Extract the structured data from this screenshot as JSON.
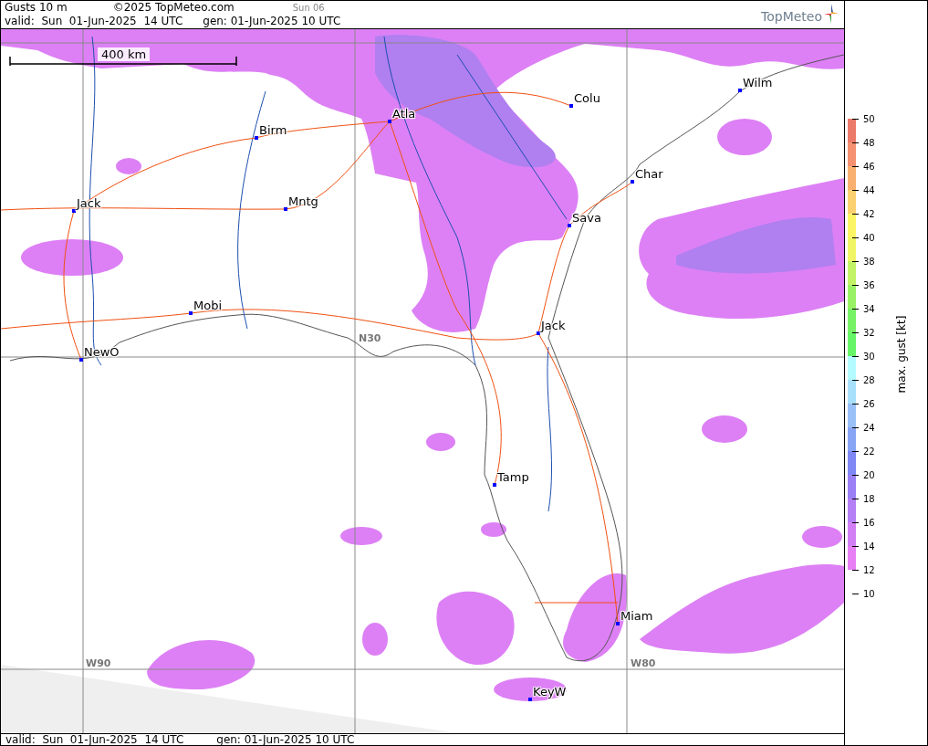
{
  "header": {
    "title": "Gusts 10 m",
    "copyright": "©2025 TopMeteo.com",
    "day": "Sun 06",
    "valid": "valid:  Sun  01-Jun-2025  14 UTC",
    "generated": "gen: 01-Jun-2025 10 UTC",
    "logo": "TopMeteo"
  },
  "map": {
    "scale": "400 km",
    "grid_labels": [
      "N30",
      "W90",
      "W80"
    ],
    "cities": [
      {
        "name": "Wilm"
      },
      {
        "name": "Colu"
      },
      {
        "name": "Atla"
      },
      {
        "name": "Birm"
      },
      {
        "name": "Char"
      },
      {
        "name": "Jack"
      },
      {
        "name": "Mntg"
      },
      {
        "name": "Sava"
      },
      {
        "name": "Mobi"
      },
      {
        "name": "Jack"
      },
      {
        "name": "NewO"
      },
      {
        "name": "Tamp"
      },
      {
        "name": "Miam"
      },
      {
        "name": "KeyW"
      }
    ]
  },
  "legend": {
    "title": "max. gust [kt]",
    "ticks": [
      "50",
      "48",
      "46",
      "44",
      "42",
      "40",
      "38",
      "36",
      "34",
      "32",
      "30",
      "28",
      "26",
      "24",
      "22",
      "20",
      "18",
      "16",
      "14",
      "12",
      "10"
    ],
    "bands": [
      {
        "color": "#ec7a6a"
      },
      {
        "color": "#f59070"
      },
      {
        "color": "#f9b070"
      },
      {
        "color": "#fbd070"
      },
      {
        "color": "#fbf566"
      },
      {
        "color": "#f0f566"
      },
      {
        "color": "#c2f266"
      },
      {
        "color": "#99f266"
      },
      {
        "color": "#77f266"
      },
      {
        "color": "#66f566"
      },
      {
        "color": "#b3fbff"
      },
      {
        "color": "#a8e0fa"
      },
      {
        "color": "#99c0f7"
      },
      {
        "color": "#88a5f5"
      },
      {
        "color": "#7f88f5"
      },
      {
        "color": "#9a7ff5"
      },
      {
        "color": "#b57ff5"
      },
      {
        "color": "#d27ff5"
      },
      {
        "color": "#e77ff5"
      }
    ]
  },
  "footer": {
    "valid": "valid:  Sun  01-Jun-2025  14 UTC",
    "generated": "gen: 01-Jun-2025 10 UTC"
  }
}
